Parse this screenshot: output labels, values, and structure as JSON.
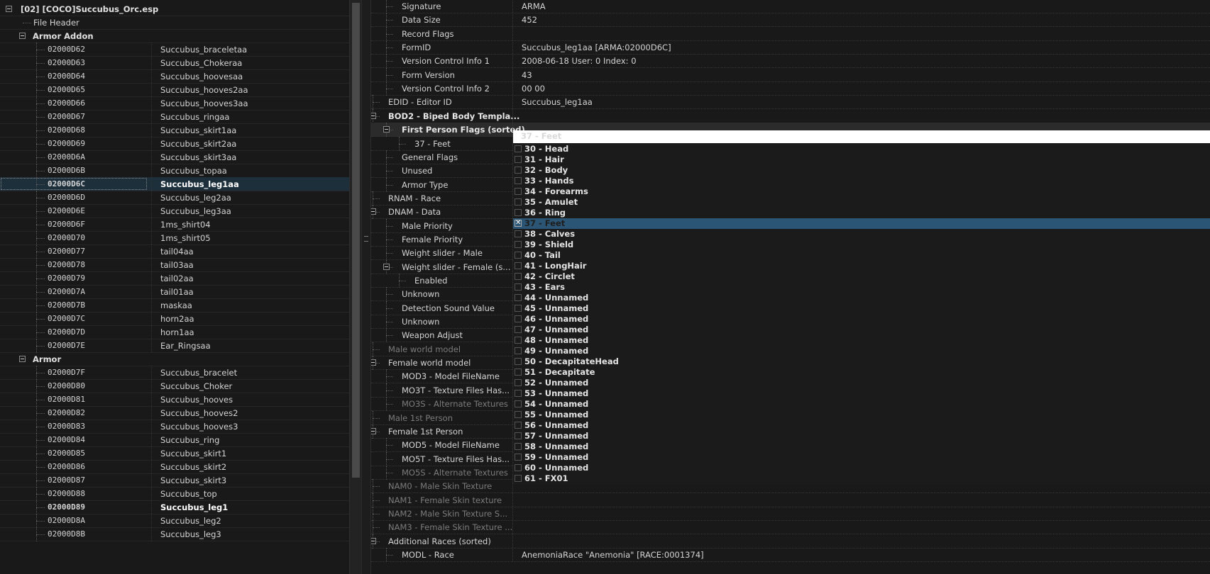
{
  "plugin_root": "[02] [COCO]Succubus_Orc.esp",
  "file_header": "File Header",
  "groups": {
    "armor_addon": "Armor Addon",
    "armor": "Armor"
  },
  "armor_addon_records": [
    {
      "id": "02000D62",
      "name": "Succubus_braceletaa"
    },
    {
      "id": "02000D63",
      "name": "Succubus_Chokeraa"
    },
    {
      "id": "02000D64",
      "name": "Succubus_hoovesaa"
    },
    {
      "id": "02000D65",
      "name": "Succubus_hooves2aa"
    },
    {
      "id": "02000D66",
      "name": "Succubus_hooves3aa"
    },
    {
      "id": "02000D67",
      "name": "Succubus_ringaa"
    },
    {
      "id": "02000D68",
      "name": "Succubus_skirt1aa"
    },
    {
      "id": "02000D69",
      "name": "Succubus_skirt2aa"
    },
    {
      "id": "02000D6A",
      "name": "Succubus_skirt3aa"
    },
    {
      "id": "02000D6B",
      "name": "Succubus_topaa"
    },
    {
      "id": "02000D6C",
      "name": "Succubus_leg1aa"
    },
    {
      "id": "02000D6D",
      "name": "Succubus_leg2aa"
    },
    {
      "id": "02000D6E",
      "name": "Succubus_leg3aa"
    },
    {
      "id": "02000D6F",
      "name": "1ms_shirt04"
    },
    {
      "id": "02000D70",
      "name": "1ms_shirt05"
    },
    {
      "id": "02000D77",
      "name": "tail04aa"
    },
    {
      "id": "02000D78",
      "name": "tail03aa"
    },
    {
      "id": "02000D79",
      "name": "tail02aa"
    },
    {
      "id": "02000D7A",
      "name": "tail01aa"
    },
    {
      "id": "02000D7B",
      "name": "maskaa"
    },
    {
      "id": "02000D7C",
      "name": "horn2aa"
    },
    {
      "id": "02000D7D",
      "name": "horn1aa"
    },
    {
      "id": "02000D7E",
      "name": "Ear_Ringsaa"
    }
  ],
  "armor_records": [
    {
      "id": "02000D7F",
      "name": "Succubus_bracelet"
    },
    {
      "id": "02000D80",
      "name": "Succubus_Choker"
    },
    {
      "id": "02000D81",
      "name": "Succubus_hooves"
    },
    {
      "id": "02000D82",
      "name": "Succubus_hooves2"
    },
    {
      "id": "02000D83",
      "name": "Succubus_hooves3"
    },
    {
      "id": "02000D84",
      "name": "Succubus_ring"
    },
    {
      "id": "02000D85",
      "name": "Succubus_skirt1"
    },
    {
      "id": "02000D86",
      "name": "Succubus_skirt2"
    },
    {
      "id": "02000D87",
      "name": "Succubus_skirt3"
    },
    {
      "id": "02000D88",
      "name": "Succubus_top"
    },
    {
      "id": "02000D89",
      "name": "Succubus_leg1",
      "bold": true
    },
    {
      "id": "02000D8A",
      "name": "Succubus_leg2"
    },
    {
      "id": "02000D8B",
      "name": "Succubus_leg3"
    }
  ],
  "selected_left_id": "02000D6C",
  "details": [
    {
      "label": "Signature",
      "value": "ARMA",
      "level": 2
    },
    {
      "label": "Data Size",
      "value": "452",
      "level": 2
    },
    {
      "label": "Record Flags",
      "value": "",
      "level": 2
    },
    {
      "label": "FormID",
      "value": "Succubus_leg1aa [ARMA:02000D6C]",
      "level": 2
    },
    {
      "label": "Version Control Info 1",
      "value": "2008-06-18 User: 0 Index: 0",
      "level": 2
    },
    {
      "label": "Form Version",
      "value": "43",
      "level": 2
    },
    {
      "label": "Version Control Info 2",
      "value": "00 00",
      "level": 2
    },
    {
      "label": "EDID - Editor ID",
      "value": "Succubus_leg1aa",
      "level": 1
    },
    {
      "label": "BOD2 - Biped Body Templa...",
      "value": "",
      "level": 1,
      "bold": true,
      "exp": true
    },
    {
      "label": "First Person Flags (sorted)",
      "value": "",
      "level": 2,
      "bold": true,
      "exp": true,
      "hl": true
    },
    {
      "label": "37 - Feet",
      "value": "",
      "level": 3
    },
    {
      "label": "General Flags",
      "value": "",
      "level": 2
    },
    {
      "label": "Unused",
      "value": "",
      "level": 2
    },
    {
      "label": "Armor Type",
      "value": "",
      "level": 2
    },
    {
      "label": "RNAM - Race",
      "value": "",
      "level": 1
    },
    {
      "label": "DNAM - Data",
      "value": "",
      "level": 1,
      "exp": true
    },
    {
      "label": "Male Priority",
      "value": "",
      "level": 2
    },
    {
      "label": "Female Priority",
      "value": "",
      "level": 2
    },
    {
      "label": "Weight slider - Male",
      "value": "",
      "level": 2
    },
    {
      "label": "Weight slider - Female (s...",
      "value": "",
      "level": 2,
      "exp": true
    },
    {
      "label": "Enabled",
      "value": "",
      "level": 3
    },
    {
      "label": "Unknown",
      "value": "",
      "level": 2
    },
    {
      "label": "Detection Sound Value",
      "value": "",
      "level": 2
    },
    {
      "label": "Unknown",
      "value": "",
      "level": 2
    },
    {
      "label": "Weapon Adjust",
      "value": "",
      "level": 2
    },
    {
      "label": "Male world model",
      "value": "",
      "level": 1,
      "grey": true
    },
    {
      "label": "Female world model",
      "value": "",
      "level": 1,
      "exp": true
    },
    {
      "label": "MOD3 - Model FileName",
      "value": "",
      "level": 2
    },
    {
      "label": "MO3T - Texture Files Has...",
      "value": "",
      "level": 2
    },
    {
      "label": "MO3S - Alternate Textures",
      "value": "",
      "level": 2,
      "grey": true
    },
    {
      "label": "Male 1st Person",
      "value": "",
      "level": 1,
      "grey": true
    },
    {
      "label": "Female 1st Person",
      "value": "",
      "level": 1,
      "exp": true
    },
    {
      "label": "MOD5 - Model FileName",
      "value": "",
      "level": 2
    },
    {
      "label": "MO5T - Texture Files Has...",
      "value": "",
      "level": 2
    },
    {
      "label": "MO5S - Alternate Textures",
      "value": "",
      "level": 2,
      "grey": true
    },
    {
      "label": "NAM0 - Male Skin Texture",
      "value": "",
      "level": 1,
      "grey": true
    },
    {
      "label": "NAM1 - Female Skin texture",
      "value": "",
      "level": 1,
      "grey": true
    },
    {
      "label": "NAM2 - Male Skin Texture S...",
      "value": "",
      "level": 1,
      "grey": true
    },
    {
      "label": "NAM3 - Female Skin Texture ...",
      "value": "",
      "level": 1,
      "grey": true
    },
    {
      "label": "Additional Races (sorted)",
      "value": "",
      "level": 1,
      "exp": true
    },
    {
      "label": "MODL - Race",
      "value": "AnemoniaRace \"Anemonia\" [RACE:0001374]",
      "level": 2
    }
  ],
  "dropdown": {
    "edit_text": "37 - Feet",
    "items": [
      {
        "label": "30 - Head",
        "checked": false
      },
      {
        "label": "31 - Hair",
        "checked": false
      },
      {
        "label": "32 - Body",
        "checked": false
      },
      {
        "label": "33 - Hands",
        "checked": false
      },
      {
        "label": "34 - Forearms",
        "checked": false
      },
      {
        "label": "35 - Amulet",
        "checked": false
      },
      {
        "label": "36 - Ring",
        "checked": false
      },
      {
        "label": "37 - Feet",
        "checked": true,
        "selected": true
      },
      {
        "label": "38 - Calves",
        "checked": false
      },
      {
        "label": "39 - Shield",
        "checked": false
      },
      {
        "label": "40 - Tail",
        "checked": false
      },
      {
        "label": "41 - LongHair",
        "checked": false
      },
      {
        "label": "42 - Circlet",
        "checked": false
      },
      {
        "label": "43 - Ears",
        "checked": false
      },
      {
        "label": "44 - Unnamed",
        "checked": false
      },
      {
        "label": "45 - Unnamed",
        "checked": false
      },
      {
        "label": "46 - Unnamed",
        "checked": false
      },
      {
        "label": "47 - Unnamed",
        "checked": false
      },
      {
        "label": "48 - Unnamed",
        "checked": false
      },
      {
        "label": "49 - Unnamed",
        "checked": false
      },
      {
        "label": "50 - DecapitateHead",
        "checked": false
      },
      {
        "label": "51 - Decapitate",
        "checked": false
      },
      {
        "label": "52 - Unnamed",
        "checked": false
      },
      {
        "label": "53 - Unnamed",
        "checked": false
      },
      {
        "label": "54 - Unnamed",
        "checked": false
      },
      {
        "label": "55 - Unnamed",
        "checked": false
      },
      {
        "label": "56 - Unnamed",
        "checked": false
      },
      {
        "label": "57 - Unnamed",
        "checked": false
      },
      {
        "label": "58 - Unnamed",
        "checked": false
      },
      {
        "label": "59 - Unnamed",
        "checked": false
      },
      {
        "label": "60 - Unnamed",
        "checked": false
      },
      {
        "label": "61 - FX01",
        "checked": false
      }
    ]
  },
  "colors": {
    "background": "#191919",
    "selection": "#2b5574",
    "row_selected": "#1c2f3b"
  }
}
